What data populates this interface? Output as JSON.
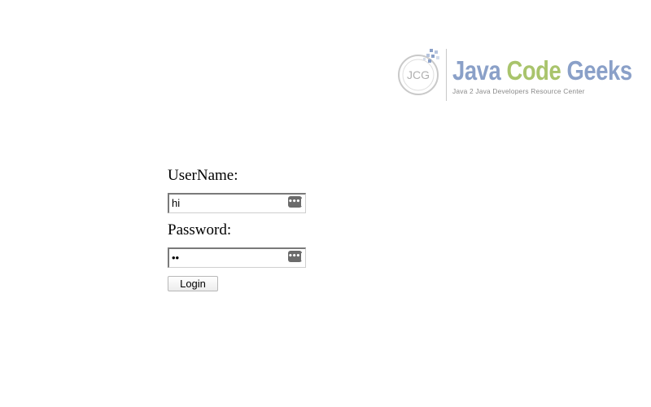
{
  "logo": {
    "word1": "Java",
    "word2": "Code",
    "word3": "Geeks",
    "emblem_text": "JCG",
    "tagline": "Java 2 Java Developers Resource Center"
  },
  "form": {
    "username_label": "UserName:",
    "username_value": "hi",
    "password_label": "Password:",
    "password_value": "ab",
    "login_label": "Login"
  },
  "icons": {
    "credential_key": "password-key-icon"
  }
}
